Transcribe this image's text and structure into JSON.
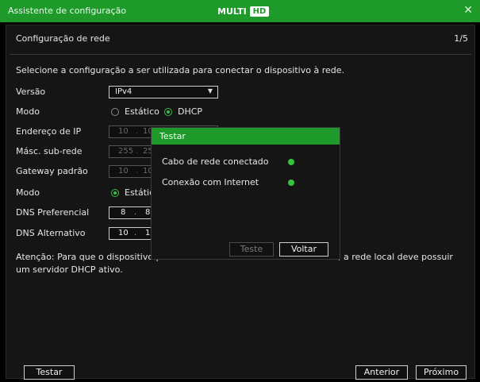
{
  "window": {
    "title": "Assistente de configuração",
    "logo_text": "MULTI",
    "logo_badge": "HD",
    "close_symbol": "✕"
  },
  "page": {
    "title": "Configuração de rede",
    "step": "1/5",
    "intro": "Selecione a configuração a ser utilizada para conectar o dispositivo à rede."
  },
  "form": {
    "version": {
      "label": "Versão",
      "value": "IPv4",
      "caret": "▼"
    },
    "mode": {
      "label": "Modo",
      "options": [
        "Estático",
        "DHCP"
      ],
      "selected": "DHCP"
    },
    "ip": {
      "label": "Endereço de IP",
      "octets": [
        "10",
        "10"
      ]
    },
    "mask": {
      "label": "Másc. sub-rede",
      "octets": [
        "255",
        "25"
      ]
    },
    "gateway": {
      "label": "Gateway padrão",
      "octets": [
        "10",
        "10"
      ]
    },
    "dns_mode": {
      "label": "Modo",
      "option": "Estátic"
    },
    "dns_pref": {
      "label": "DNS Preferencial",
      "octets": [
        "8",
        "8"
      ]
    },
    "dns_alt": {
      "label": "DNS Alternativo",
      "octets": [
        "10",
        "1"
      ]
    }
  },
  "note": {
    "line1_left": "Atenção: Para que o dispositivo po",
    "line1_right": ", a rede local deve possuir",
    "line2": "um servidor DHCP ativo."
  },
  "footer": {
    "test": "Testar",
    "prev": "Anterior",
    "next": "Próximo"
  },
  "dialog": {
    "title": "Testar",
    "items": [
      {
        "label": "Cabo de rede conectado",
        "status_color": "#33c43f"
      },
      {
        "label": "Conexão com Internet",
        "status_color": "#33c43f"
      }
    ],
    "test_button": "Teste",
    "back_button": "Voltar"
  },
  "colors": {
    "accent": "#1e9a2b",
    "status_ok": "#33c43f",
    "background": "#000000",
    "panel": "#151515"
  }
}
